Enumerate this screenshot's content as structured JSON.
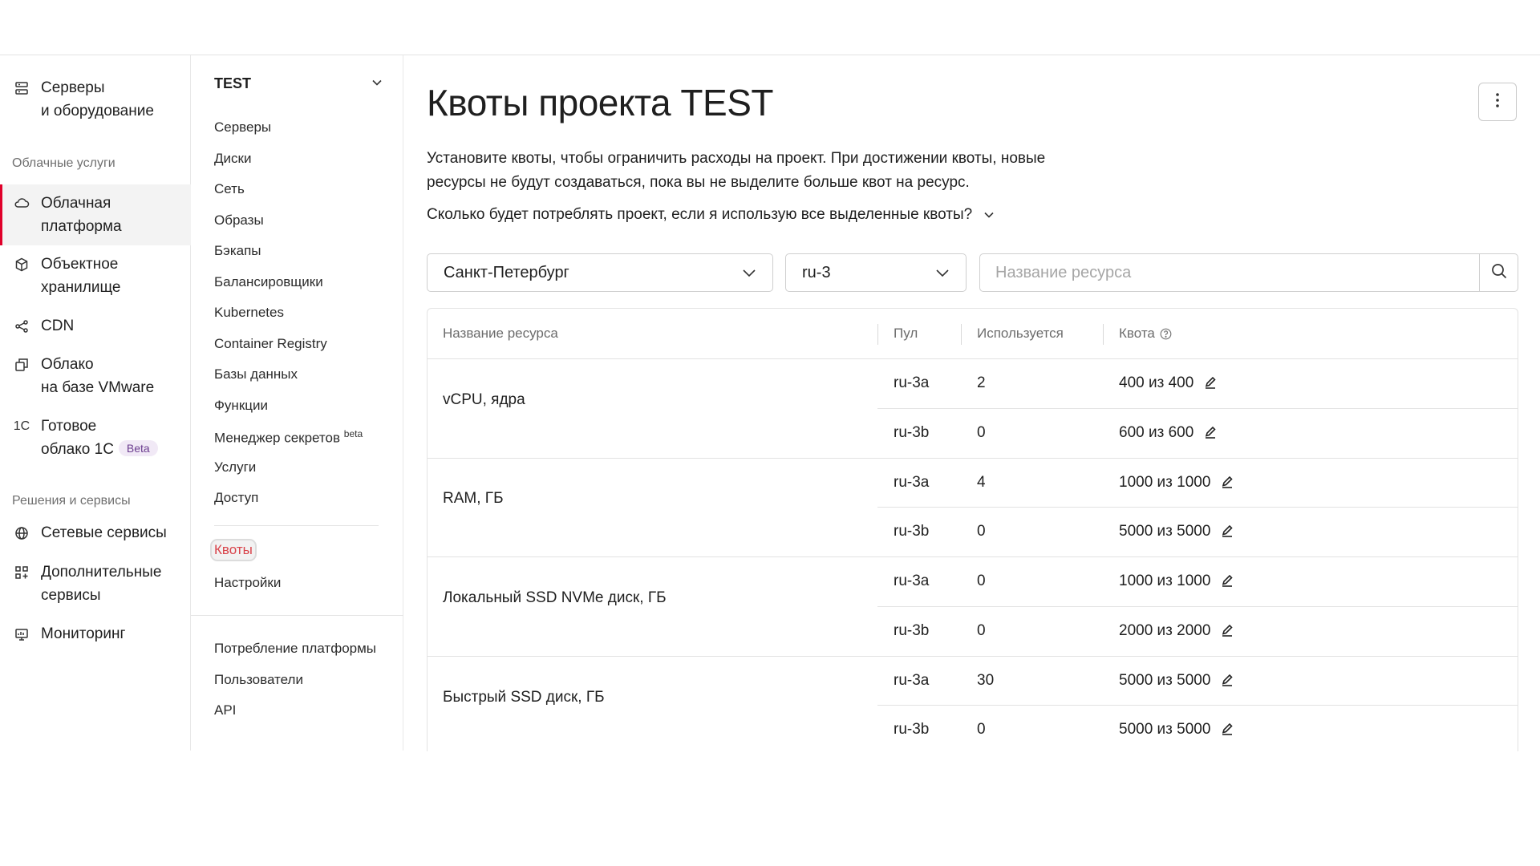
{
  "sidebar": {
    "items": [
      {
        "icon": "server-icon",
        "label1": "Серверы",
        "label2": "и оборудование"
      },
      {
        "icon": "cloud-icon",
        "label1": "Облачная",
        "label2": "платформа"
      },
      {
        "icon": "cube-icon",
        "label1": "Объектное",
        "label2": "хранилище"
      },
      {
        "icon": "cdn-icon",
        "label1": "CDN",
        "label2": ""
      },
      {
        "icon": "vmware-icon",
        "label1": "Облако",
        "label2": "на базе VMware"
      },
      {
        "icon": "onec-icon",
        "label1": "Готовое",
        "label2": "облако 1С",
        "badge": "Beta",
        "glyph": "1C"
      },
      {
        "icon": "globe-icon",
        "label1": "Сетевые сервисы",
        "label2": ""
      },
      {
        "icon": "grid-icon",
        "label1": "Дополнительные",
        "label2": "сервисы"
      },
      {
        "icon": "monitor-icon",
        "label1": "Мониторинг",
        "label2": ""
      }
    ],
    "sections": [
      "Облачные услуги",
      "Решения и сервисы"
    ]
  },
  "project_menu": {
    "title": "TEST",
    "items": [
      "Серверы",
      "Диски",
      "Сеть",
      "Образы",
      "Бэкапы",
      "Балансировщики",
      "Kubernetes",
      "Container Registry",
      "Базы данных",
      "Функции",
      "Менеджер секретов",
      "Услуги",
      "Доступ"
    ],
    "secrets_sup": "beta",
    "quotas": "Квоты",
    "settings": "Настройки",
    "bottom": [
      "Потребление платформы",
      "Пользователи",
      "API"
    ]
  },
  "main": {
    "title": "Квоты проекта TEST",
    "desc_line1": "Установите квоты, чтобы ограничить расходы на проект. При достижении квоты, новые",
    "desc_line2": "ресурсы не будут создаваться, пока вы не выделите больше квот на ресурс.",
    "faq": "Сколько будет потреблять проект, если я использую все выделенные квоты?",
    "region": "Санкт-Петербург",
    "pool_select": "ru-3",
    "search_placeholder": "Название ресурса"
  },
  "table": {
    "headers": {
      "name": "Название ресурса",
      "pool": "Пул",
      "used": "Используется",
      "quota": "Квота"
    },
    "groups": [
      {
        "name": "vCPU, ядра",
        "rows": [
          {
            "pool": "ru-3a",
            "used": "2",
            "quota": "400 из 400"
          },
          {
            "pool": "ru-3b",
            "used": "0",
            "quota": "600 из 600"
          }
        ]
      },
      {
        "name": "RAM, ГБ",
        "rows": [
          {
            "pool": "ru-3a",
            "used": "4",
            "quota": "1000 из 1000"
          },
          {
            "pool": "ru-3b",
            "used": "0",
            "quota": "5000 из 5000"
          }
        ]
      },
      {
        "name": "Локальный SSD NVMe диск, ГБ",
        "rows": [
          {
            "pool": "ru-3a",
            "used": "0",
            "quota": "1000 из 1000"
          },
          {
            "pool": "ru-3b",
            "used": "0",
            "quota": "2000 из 2000"
          }
        ]
      },
      {
        "name": "Быстрый SSD диск, ГБ",
        "rows": [
          {
            "pool": "ru-3a",
            "used": "30",
            "quota": "5000 из 5000"
          },
          {
            "pool": "ru-3b",
            "used": "0",
            "quota": "5000 из 5000"
          }
        ]
      }
    ]
  },
  "colors": {
    "accent": "#e0002a",
    "selected_text": "#d9434a",
    "badge_bg": "#f1e9f6",
    "badge_text": "#6b3d8f"
  }
}
